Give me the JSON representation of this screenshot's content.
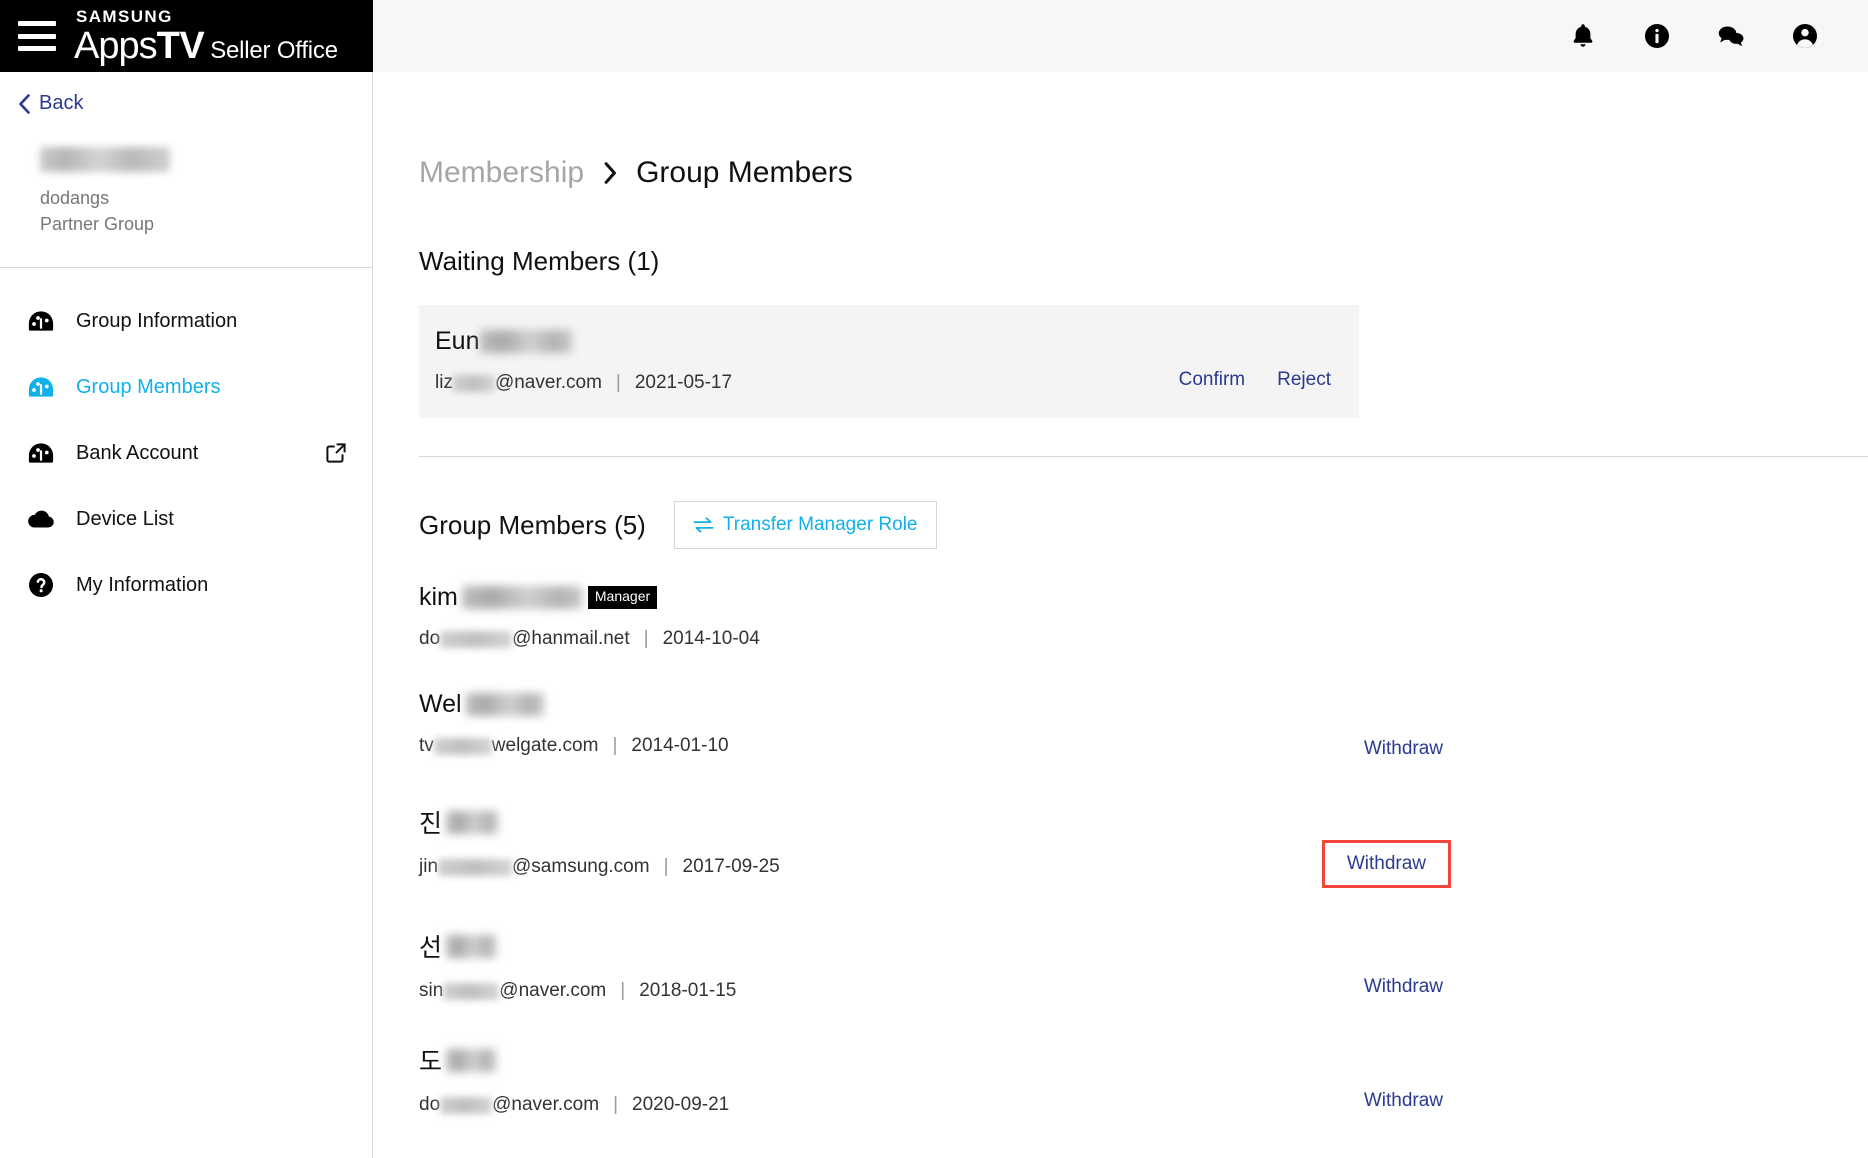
{
  "header": {
    "brand_samsung": "SAMSUNG",
    "brand_apps": "Apps",
    "brand_tv": "TV",
    "brand_office": "Seller Office",
    "icons": [
      "bell-icon",
      "info-circle-icon",
      "chat-icon",
      "account-circle-icon"
    ]
  },
  "sidebar": {
    "back_label": "Back",
    "group": {
      "name_redacted": "",
      "account": "dodangs",
      "type": "Partner Group"
    },
    "items": [
      {
        "label": "Group Information",
        "icon": "gauge-icon",
        "active": false,
        "external": false
      },
      {
        "label": "Group Members",
        "icon": "gauge-icon",
        "active": true,
        "external": false
      },
      {
        "label": "Bank Account",
        "icon": "gauge-icon",
        "active": false,
        "external": true
      },
      {
        "label": "Device List",
        "icon": "cloud-icon",
        "active": false,
        "external": false
      },
      {
        "label": "My Information",
        "icon": "question-circle-icon",
        "active": false,
        "external": false
      }
    ]
  },
  "breadcrumb": {
    "parent": "Membership",
    "separator": "›",
    "current": "Group Members"
  },
  "waiting": {
    "title": "Waiting Members (1)",
    "member": {
      "name_visible": "Eun",
      "email_prefix": "liz",
      "email_suffix": "@naver.com",
      "separator": "|",
      "date": "2021-05-17"
    },
    "confirm_label": "Confirm",
    "reject_label": "Reject"
  },
  "members": {
    "title": "Group Members (5)",
    "transfer_label": "Transfer Manager Role",
    "transfer_icon": "transfer-arrows-icon",
    "withdraw_label": "Withdraw",
    "manager_badge": "Manager",
    "separator": "|",
    "rows": [
      {
        "name_visible": "kim",
        "name_blur_width": 120,
        "is_manager": true,
        "email_prefix": "do",
        "email_blur_width": 72,
        "email_suffix": "@hanmail.net",
        "date": "2014-10-04",
        "withdrawable": false,
        "highlighted": false
      },
      {
        "name_visible": "Wel",
        "name_blur_width": 78,
        "is_manager": false,
        "email_prefix": "tv",
        "email_blur_width": 58,
        "email_suffix": "welgate.com",
        "date": "2014-01-10",
        "withdrawable": true,
        "highlighted": false
      },
      {
        "name_visible": "진",
        "name_blur_width": 52,
        "is_manager": false,
        "email_prefix": "jin",
        "email_blur_width": 74,
        "email_suffix": "@samsung.com",
        "date": "2017-09-25",
        "withdrawable": true,
        "highlighted": true
      },
      {
        "name_visible": "선",
        "name_blur_width": 50,
        "is_manager": false,
        "email_prefix": "sin",
        "email_blur_width": 56,
        "email_suffix": "@naver.com",
        "date": "2018-01-15",
        "withdrawable": true,
        "highlighted": false
      },
      {
        "name_visible": "도",
        "name_blur_width": 50,
        "is_manager": false,
        "email_prefix": "do",
        "email_blur_width": 52,
        "email_suffix": "@naver.com",
        "date": "2020-09-21",
        "withdrawable": true,
        "highlighted": false
      }
    ]
  },
  "colors": {
    "accent_cyan": "#12b0e8",
    "link_navy": "#2b3a8f",
    "highlight_red": "#f5453f",
    "header_black": "#000000",
    "card_gray": "#f4f4f4"
  }
}
